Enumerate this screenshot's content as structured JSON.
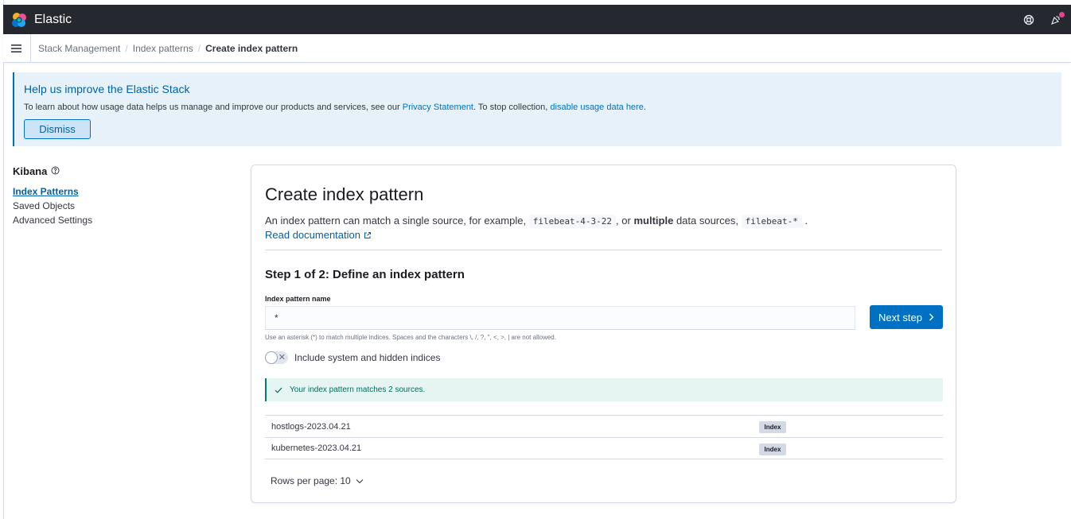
{
  "header": {
    "brand": "Elastic"
  },
  "breadcrumbs": [
    "Stack Management",
    "Index patterns",
    "Create index pattern"
  ],
  "callout": {
    "title": "Help us improve the Elastic Stack",
    "text_before": "To learn about how usage data helps us manage and improve our products and services, see our ",
    "privacy_link": "Privacy Statement",
    "text_middle": ". To stop collection, ",
    "disable_link": "disable usage data here",
    "text_after": ".",
    "dismiss_label": "Dismiss"
  },
  "sidebar": {
    "title": "Kibana",
    "items": [
      {
        "label": "Index Patterns",
        "active": true
      },
      {
        "label": "Saved Objects",
        "active": false
      },
      {
        "label": "Advanced Settings",
        "active": false
      }
    ]
  },
  "panel": {
    "title": "Create index pattern",
    "desc_1": "An index pattern can match a single source, for example,",
    "code_1": "filebeat-4-3-22",
    "desc_2": ", or",
    "desc_bold": "multiple",
    "desc_3": "data sources,",
    "code_2": "filebeat-*",
    "desc_4": ".",
    "doc_link": "Read documentation",
    "step_title": "Step 1 of 2: Define an index pattern",
    "field_label": "Index pattern name",
    "field_value": "*",
    "next_label": "Next step",
    "help_text": "Use an asterisk (*) to match multiple indices. Spaces and the characters \\, /, ?, \", <, >, | are not allowed.",
    "toggle_label": "Include system and hidden indices",
    "toggle_on": false,
    "success_text": "Your index pattern matches 2 sources.",
    "rows": [
      {
        "name": "hostlogs-2023.04.21",
        "badge": "Index"
      },
      {
        "name": "kubernetes-2023.04.21",
        "badge": "Index"
      }
    ],
    "rows_per_page": "Rows per page: 10"
  },
  "colors": {
    "header_bg": "#25282f",
    "primary": "#0071c2",
    "success": "#00806f",
    "notification_dot": "#e7438f"
  }
}
